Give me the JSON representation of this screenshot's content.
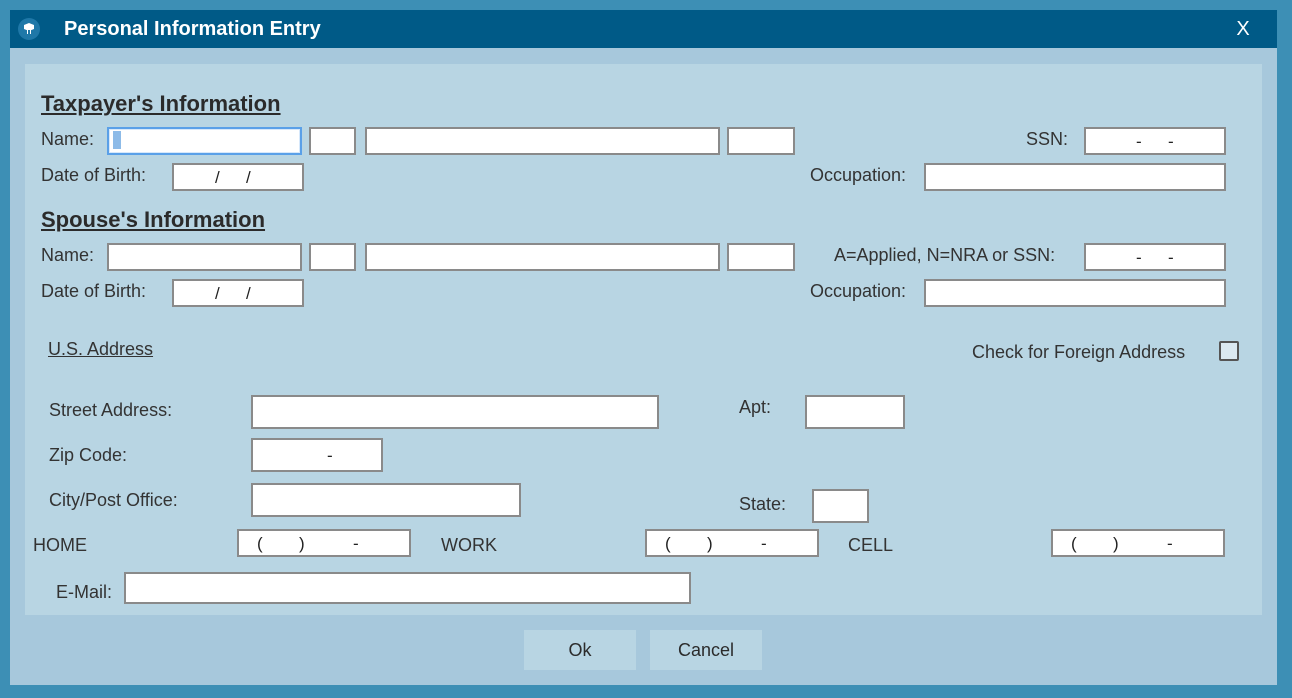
{
  "window": {
    "title": "Personal Information Entry",
    "close_label": "X"
  },
  "taxpayer": {
    "heading": "Taxpayer's Information",
    "name_label": "Name:",
    "ssn_label": "SSN:",
    "dob_label": "Date of Birth:",
    "occupation_label": "Occupation:",
    "first_name": "",
    "middle_initial": "",
    "last_name": "",
    "suffix": "",
    "occupation": ""
  },
  "spouse": {
    "heading": "Spouse's Information",
    "name_label": "Name:",
    "ssn_label": "A=Applied, N=NRA or SSN:",
    "dob_label": "Date of Birth:",
    "occupation_label": "Occupation:",
    "first_name": "",
    "middle_initial": "",
    "last_name": "",
    "suffix": "",
    "occupation": ""
  },
  "masks": {
    "ssn_sep": "-",
    "date_sep": "/",
    "zip_sep": "-",
    "phone_open": "(",
    "phone_close": ")",
    "phone_sep": "-"
  },
  "address": {
    "us_address_link": "U.S. Address",
    "foreign_checkbox_label": "Check for Foreign Address",
    "foreign_checked": false,
    "street_label": "Street Address:",
    "apt_label": "Apt:",
    "zip_label": "Zip Code:",
    "city_label": "City/Post Office:",
    "state_label": "State:",
    "street": "",
    "apt": "",
    "city": "",
    "state": ""
  },
  "phones": {
    "home_label": "HOME",
    "work_label": "WORK",
    "cell_label": "CELL"
  },
  "email": {
    "label": "E-Mail:",
    "value": ""
  },
  "buttons": {
    "ok": "Ok",
    "cancel": "Cancel"
  },
  "colors": {
    "titlebar": "#005a87",
    "dialog_bg": "#a7c8dc",
    "panel_bg": "#b8d5e3",
    "focus_border": "#5aa0e8"
  }
}
